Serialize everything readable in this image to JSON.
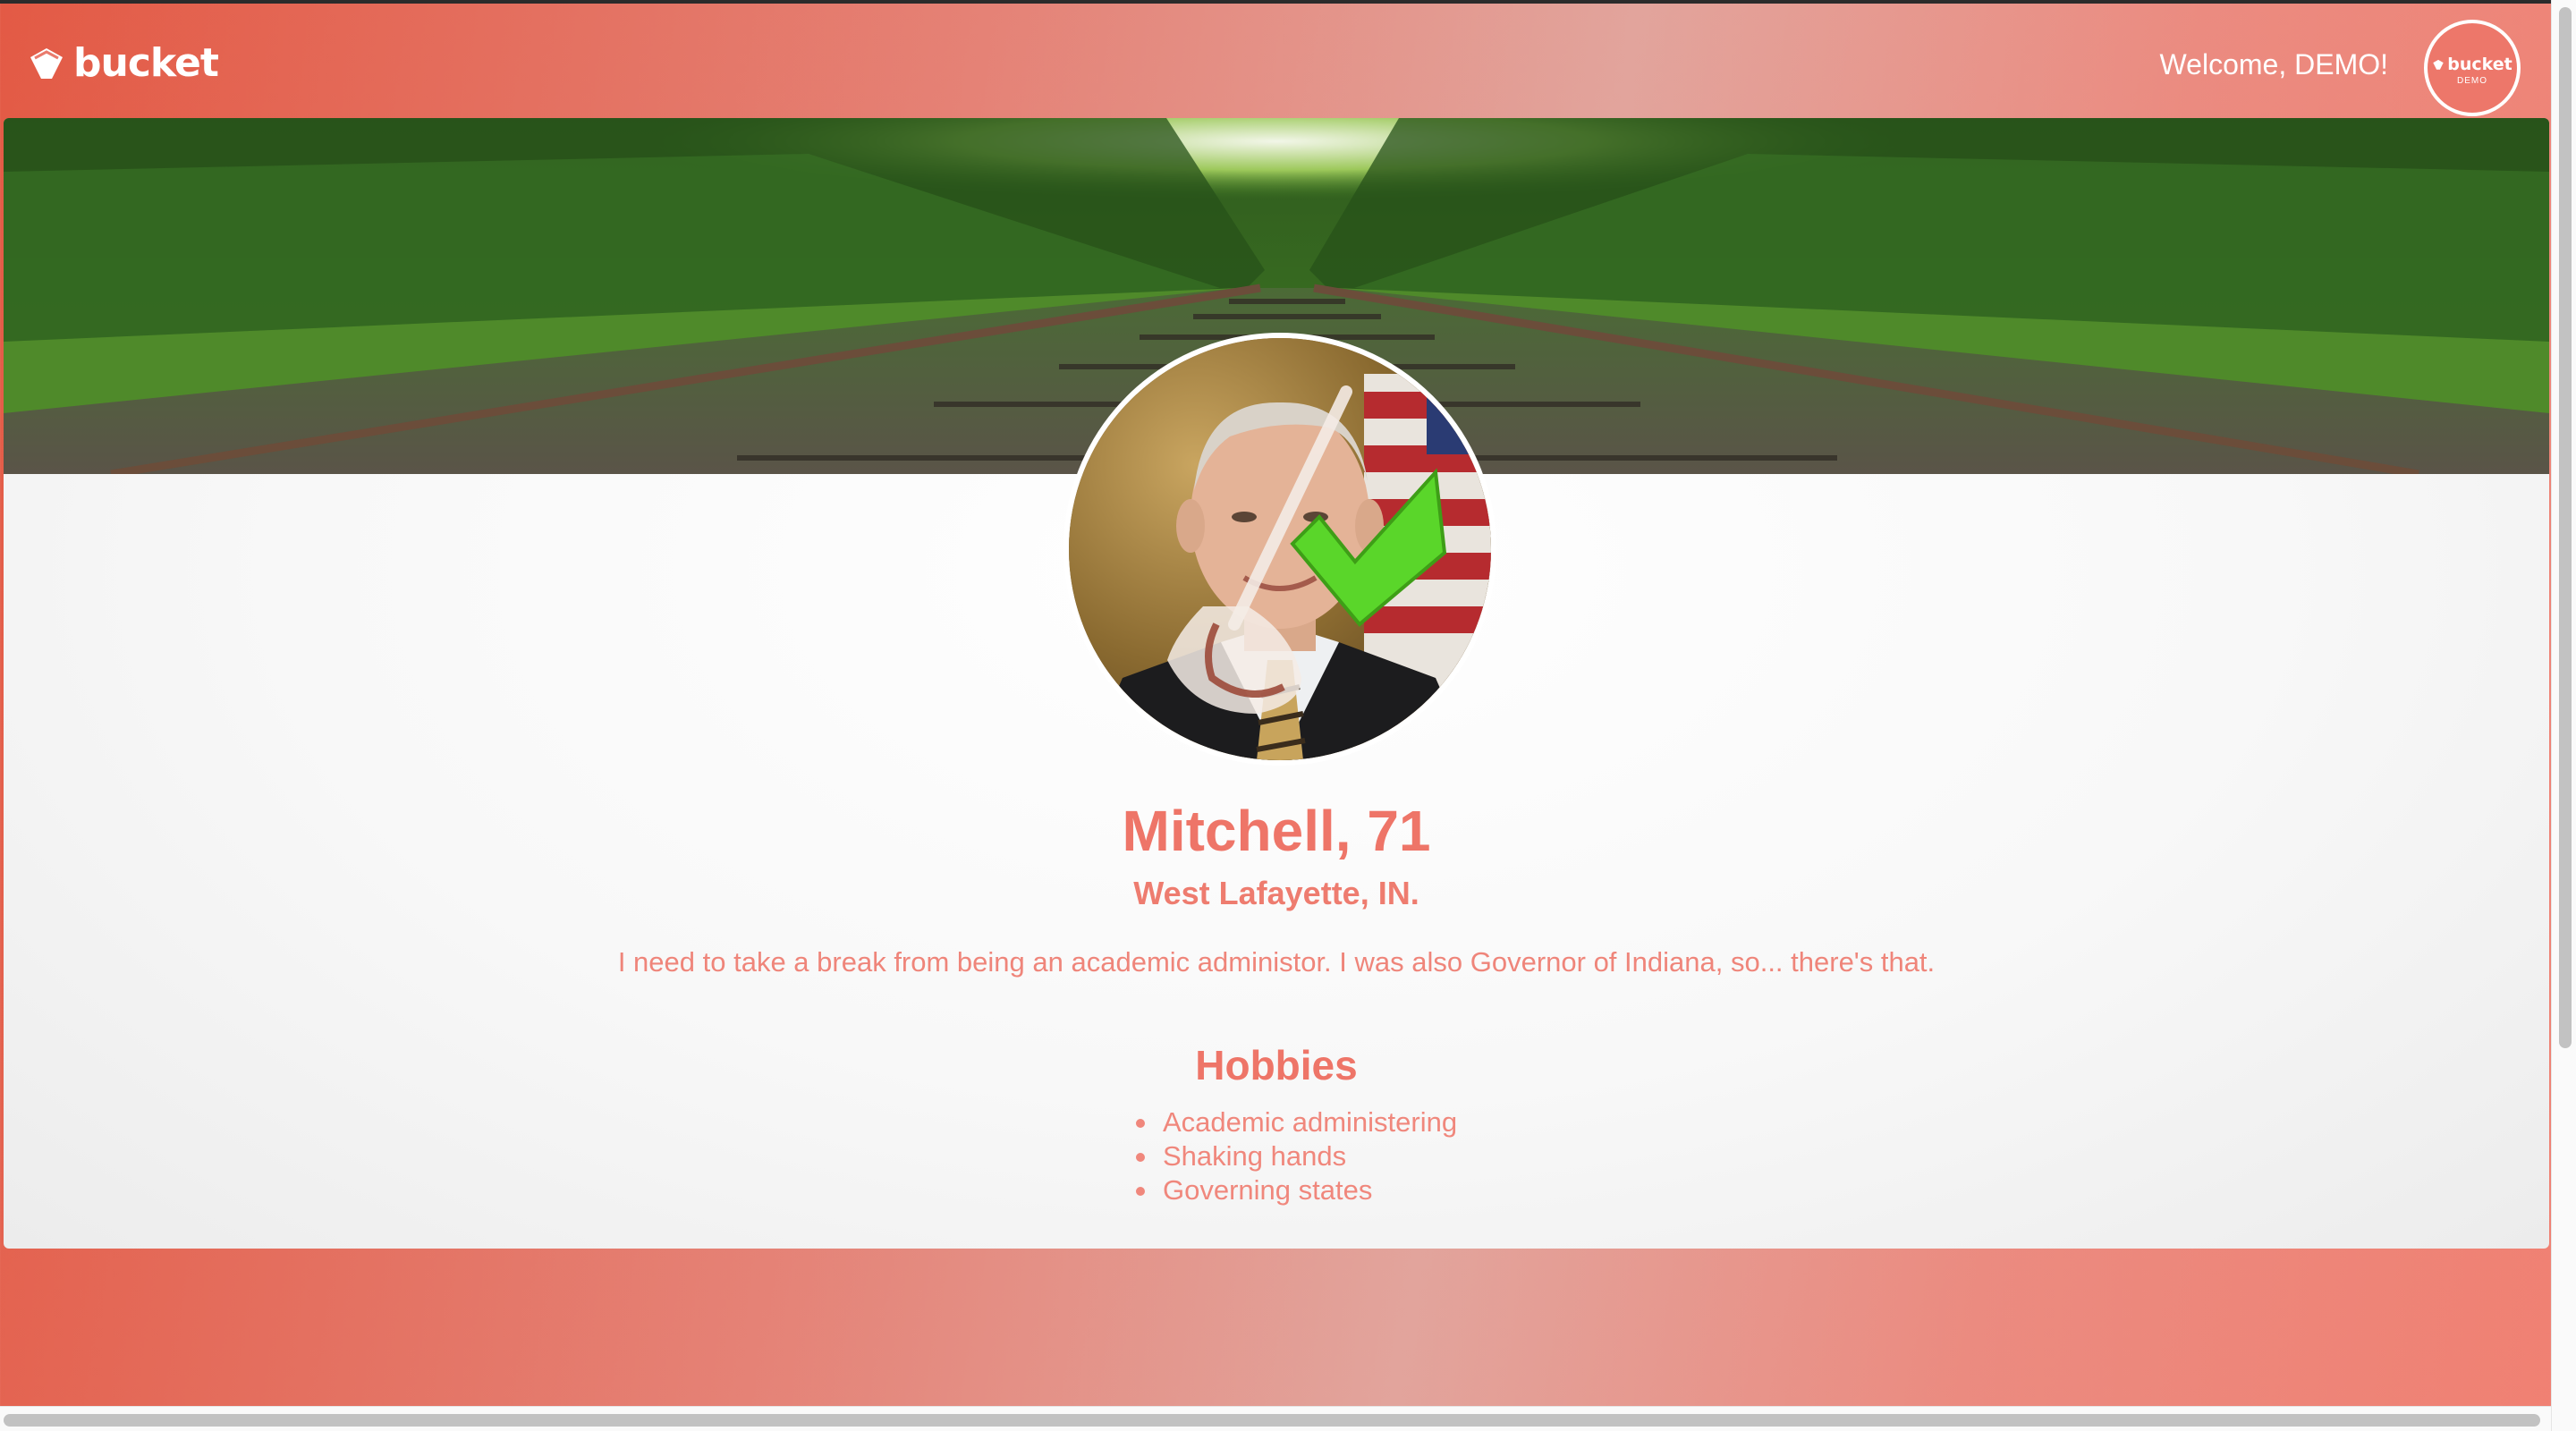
{
  "header": {
    "logo_text": "bucket",
    "welcome_text": "Welcome, DEMO!",
    "avatar": {
      "brand": "bucket",
      "label": "DEMO"
    }
  },
  "profile": {
    "name_age": "Mitchell, 71",
    "location": "West Lafayette, IN.",
    "bio": "I need to take a break from being an academic administor. I was also Governor of Indiana, so... there's that.",
    "hobbies_title": "Hobbies",
    "hobbies": [
      "Academic administering",
      "Shaking hands",
      "Governing states"
    ]
  },
  "colors": {
    "accent": "#ee7568",
    "check_green": "#5ad62a"
  },
  "icons": {
    "logo": "bucket-logo-icon",
    "profile_overlay": [
      "broom-icon",
      "checkmark-icon"
    ]
  }
}
